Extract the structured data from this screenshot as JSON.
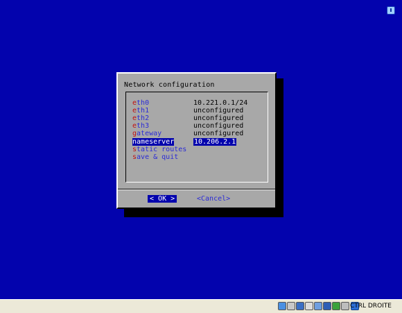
{
  "dialog": {
    "title": "Network configuration",
    "items": [
      {
        "hot": "e",
        "rest": "th0",
        "value": "10.221.0.1/24",
        "selected": false
      },
      {
        "hot": "e",
        "rest": "th1",
        "value": "unconfigured",
        "selected": false
      },
      {
        "hot": "e",
        "rest": "th2",
        "value": "unconfigured",
        "selected": false
      },
      {
        "hot": "e",
        "rest": "th3",
        "value": "unconfigured",
        "selected": false
      },
      {
        "hot": "g",
        "rest": "ateway",
        "value": "unconfigured",
        "selected": false
      },
      {
        "hot": "n",
        "rest": "ameserver",
        "value": "10.206.2.1",
        "selected": true
      },
      {
        "hot": "s",
        "rest": "tatic routes",
        "value": "",
        "selected": false
      },
      {
        "hot": "s",
        "rest": "ave & quit",
        "value": "",
        "selected": false
      }
    ],
    "ok_button": {
      "left": "< ",
      "hot": "O",
      "rest": "K",
      "right": " >"
    },
    "cancel_label": "<Cancel>"
  },
  "statusbar": {
    "host_key_label": "CTRL DROITE",
    "icons": [
      "hard-disk-icon",
      "optical-drive-icon",
      "floppy-icon",
      "usb-icon",
      "shared-folders-icon",
      "display-icon",
      "network-icon",
      "mouse-integration-icon"
    ]
  },
  "colors": {
    "screen_bg": "#0303ad",
    "dialog_bg": "#a8a8a8",
    "hotkey": "#c01010",
    "menu_text": "#2b2bd6",
    "statusbar_bg": "#ece9d8"
  }
}
